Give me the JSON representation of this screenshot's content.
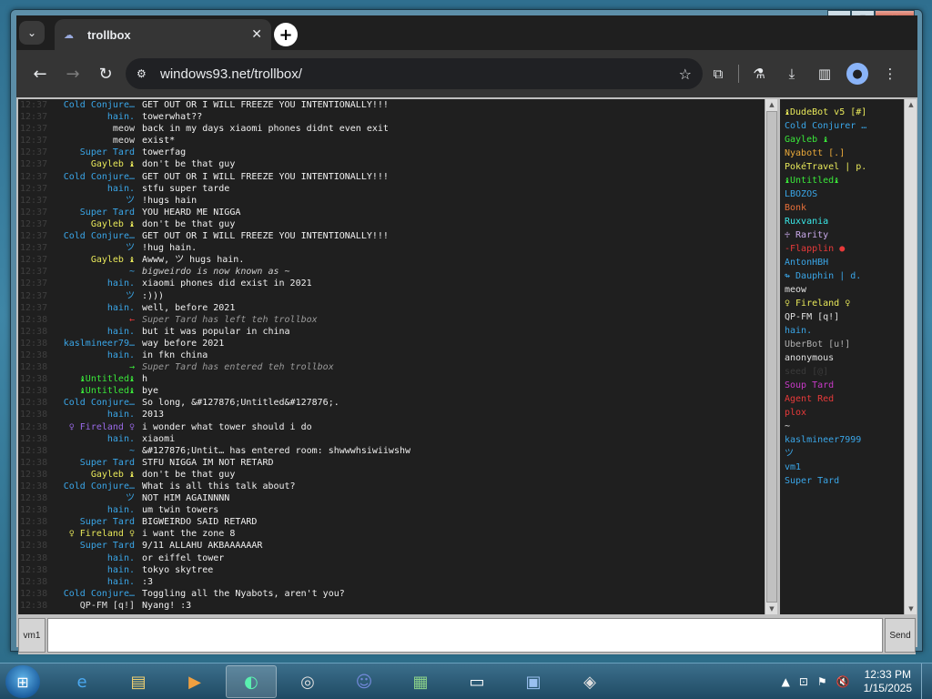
{
  "browser": {
    "tab_title": "trollbox",
    "url": "windows93.net/trollbox/"
  },
  "chat": {
    "messages": [
      {
        "time": "12:37",
        "nick": "Cold Conjure…",
        "nick_color": "#3aa6e8",
        "text": "GET OUT OR I WILL FREEZE YOU INTENTIONALLY!!!",
        "italic": false
      },
      {
        "time": "12:37",
        "nick": "hain.",
        "nick_color": "#3aa6e8",
        "text": "towerwhat??",
        "italic": false
      },
      {
        "time": "12:37",
        "nick": "meow",
        "nick_color": "#e0e0e0",
        "text": "back in my days xiaomi phones didnt even exit",
        "italic": false
      },
      {
        "time": "12:37",
        "nick": "meow",
        "nick_color": "#e0e0e0",
        "text": "exist*",
        "italic": false
      },
      {
        "time": "12:37",
        "nick": "Super Tard",
        "nick_color": "#3aa6e8",
        "text": "towerfag",
        "italic": false
      },
      {
        "time": "12:37",
        "nick": "Gayleb ♝",
        "nick_color": "#e8e85a",
        "text": "don't be that guy",
        "italic": false
      },
      {
        "time": "12:37",
        "nick": "Cold Conjure…",
        "nick_color": "#3aa6e8",
        "text": "GET OUT OR I WILL FREEZE YOU INTENTIONALLY!!!",
        "italic": false
      },
      {
        "time": "12:37",
        "nick": "hain.",
        "nick_color": "#3aa6e8",
        "text": "stfu super tarde",
        "italic": false
      },
      {
        "time": "12:37",
        "nick": "ツ",
        "nick_color": "#3aa6e8",
        "text": "!hugs hain",
        "italic": false
      },
      {
        "time": "12:37",
        "nick": "Super Tard",
        "nick_color": "#3aa6e8",
        "text": "YOU HEARD ME NIGGA",
        "italic": false
      },
      {
        "time": "12:37",
        "nick": "Gayleb ♝",
        "nick_color": "#e8e85a",
        "text": "don't be that guy",
        "italic": false
      },
      {
        "time": "12:37",
        "nick": "Cold Conjure…",
        "nick_color": "#3aa6e8",
        "text": "GET OUT OR I WILL FREEZE YOU INTENTIONALLY!!!",
        "italic": false
      },
      {
        "time": "12:37",
        "nick": "ツ",
        "nick_color": "#3aa6e8",
        "text": "!hug hain.",
        "italic": false
      },
      {
        "time": "12:37",
        "nick": "Gayleb ♝",
        "nick_color": "#e8e85a",
        "text": "Awww, ツ hugs hain.",
        "italic": false
      },
      {
        "time": "12:37",
        "nick": "~",
        "nick_color": "#3aa6e8",
        "text": "bigweirdo is now known as ~",
        "italic": true
      },
      {
        "time": "12:37",
        "nick": "hain.",
        "nick_color": "#3aa6e8",
        "text": "xiaomi phones did exist in 2021",
        "italic": false
      },
      {
        "time": "12:37",
        "nick": "ツ",
        "nick_color": "#3aa6e8",
        "text": ":)))",
        "italic": false
      },
      {
        "time": "12:37",
        "nick": "hain.",
        "nick_color": "#3aa6e8",
        "text": "well, before 2021",
        "italic": false
      },
      {
        "time": "12:38",
        "nick": "←",
        "nick_color": "#e83a3a",
        "text": "Super Tard has left teh trollbox",
        "italic": true
      },
      {
        "time": "12:38",
        "nick": "hain.",
        "nick_color": "#3aa6e8",
        "text": "but it was popular in china",
        "italic": false
      },
      {
        "time": "12:38",
        "nick": "kaslmineer79…",
        "nick_color": "#3aa6e8",
        "text": "way before 2021",
        "italic": false
      },
      {
        "time": "12:38",
        "nick": "hain.",
        "nick_color": "#3aa6e8",
        "text": "in fkn china",
        "italic": false
      },
      {
        "time": "12:38",
        "nick": "→",
        "nick_color": "#3ae83a",
        "text": "Super Tard has entered teh trollbox",
        "italic": true
      },
      {
        "time": "12:38",
        "nick": "♝Untitled♝",
        "nick_color": "#3ae83a",
        "text": "h",
        "italic": false
      },
      {
        "time": "12:38",
        "nick": "♝Untitled♝",
        "nick_color": "#3ae83a",
        "text": "bye",
        "italic": false
      },
      {
        "time": "12:38",
        "nick": "Cold Conjure…",
        "nick_color": "#3aa6e8",
        "text": "So long, &#127876;Untitled&#127876;.",
        "italic": false
      },
      {
        "time": "12:38",
        "nick": "hain.",
        "nick_color": "#3aa6e8",
        "text": "2013",
        "italic": false
      },
      {
        "time": "12:38",
        "nick": "♀ Fireland ♀",
        "nick_color": "#9a6ae8",
        "text": "i wonder what tower should i do",
        "italic": false
      },
      {
        "time": "12:38",
        "nick": "hain.",
        "nick_color": "#3aa6e8",
        "text": "xiaomi",
        "italic": false
      },
      {
        "time": "12:38",
        "nick": "~",
        "nick_color": "#3aa6e8",
        "text": "&#127876;Untit… has entered room: shwwwhsiwiiwshw",
        "italic": false
      },
      {
        "time": "12:38",
        "nick": "Super Tard",
        "nick_color": "#3aa6e8",
        "text": "STFU NIGGA IM NOT RETARD",
        "italic": false
      },
      {
        "time": "12:38",
        "nick": "Gayleb ♝",
        "nick_color": "#e8e85a",
        "text": "don't be that guy",
        "italic": false
      },
      {
        "time": "12:38",
        "nick": "Cold Conjure…",
        "nick_color": "#3aa6e8",
        "text": "What is all this talk about?",
        "italic": false
      },
      {
        "time": "12:38",
        "nick": "ツ",
        "nick_color": "#3aa6e8",
        "text": "NOT HIM AGAINNNN",
        "italic": false
      },
      {
        "time": "12:38",
        "nick": "hain.",
        "nick_color": "#3aa6e8",
        "text": "um twin towers",
        "italic": false
      },
      {
        "time": "12:38",
        "nick": "Super Tard",
        "nick_color": "#3aa6e8",
        "text": "BIGWEIRDO SAID RETARD",
        "italic": false
      },
      {
        "time": "12:38",
        "nick": "♀ Fireland ♀",
        "nick_color": "#e8e85a",
        "text": "i want the zone 8",
        "italic": false
      },
      {
        "time": "12:38",
        "nick": "Super Tard",
        "nick_color": "#3aa6e8",
        "text": "9/11 ALLAHU AKBAAAAAAR",
        "italic": false
      },
      {
        "time": "12:38",
        "nick": "hain.",
        "nick_color": "#3aa6e8",
        "text": "or eiffel tower",
        "italic": false
      },
      {
        "time": "12:38",
        "nick": "hain.",
        "nick_color": "#3aa6e8",
        "text": "tokyo skytree",
        "italic": false
      },
      {
        "time": "12:38",
        "nick": "hain.",
        "nick_color": "#3aa6e8",
        "text": ":3",
        "italic": false
      },
      {
        "time": "12:38",
        "nick": "Cold Conjure…",
        "nick_color": "#3aa6e8",
        "text": "Toggling all the Nyabots, aren't you?",
        "italic": false
      },
      {
        "time": "12:38",
        "nick": "QP-FM [q!]",
        "nick_color": "#e0e0e0",
        "text": "Nyang! :3",
        "italic": false
      }
    ]
  },
  "users": [
    {
      "name": "♝DudeBot v5 [#]",
      "color": "#e8e85a"
    },
    {
      "name": "Cold Conjurer …",
      "color": "#3aa6e8"
    },
    {
      "name": "Gayleb ♝",
      "color": "#3ae83a"
    },
    {
      "name": "Nyabott [.]",
      "color": "#e8a83a"
    },
    {
      "name": "PokéTravel | p.",
      "color": "#e8e85a"
    },
    {
      "name": "♝Untitled♝",
      "color": "#3ae83a"
    },
    {
      "name": "LBOZOS",
      "color": "#3aa6e8"
    },
    {
      "name": "Bonk",
      "color": "#e8703a"
    },
    {
      "name": "Ruxvania",
      "color": "#3ae8e8"
    },
    {
      "name": "♱ Rarity",
      "color": "#c8a8e8"
    },
    {
      "name": "-Flapplin ●",
      "color": "#e83a3a"
    },
    {
      "name": "AntonHBH",
      "color": "#3aa6e8"
    },
    {
      "name": "↬ Dauphin | d.",
      "color": "#3aa6e8"
    },
    {
      "name": "meow",
      "color": "#e0e0e0"
    },
    {
      "name": "♀ Fireland ♀",
      "color": "#e8e85a"
    },
    {
      "name": "QP-FM [q!]",
      "color": "#e0e0e0"
    },
    {
      "name": "hain.",
      "color": "#3aa6e8"
    },
    {
      "name": "UberBot [u!]",
      "color": "#b0b0b0"
    },
    {
      "name": "anonymous",
      "color": "#e0e0e0"
    },
    {
      "name": "seed [@]",
      "color": "#3a3a3a"
    },
    {
      "name": "Soup Tard",
      "color": "#c83ac8"
    },
    {
      "name": "Agent Red",
      "color": "#e83a3a"
    },
    {
      "name": "plox",
      "color": "#e83a3a"
    },
    {
      "name": "~",
      "color": "#e0e0e0"
    },
    {
      "name": "kaslmineer7999",
      "color": "#3aa6e8"
    },
    {
      "name": "ツ",
      "color": "#3aa6e8"
    },
    {
      "name": "vm1",
      "color": "#3aa6e8"
    },
    {
      "name": "Super Tard",
      "color": "#3aa6e8"
    }
  ],
  "input": {
    "nick_label": "vm1",
    "send_label": "Send",
    "value": ""
  },
  "taskbar": {
    "time": "12:33 PM",
    "date": "1/15/2025"
  }
}
